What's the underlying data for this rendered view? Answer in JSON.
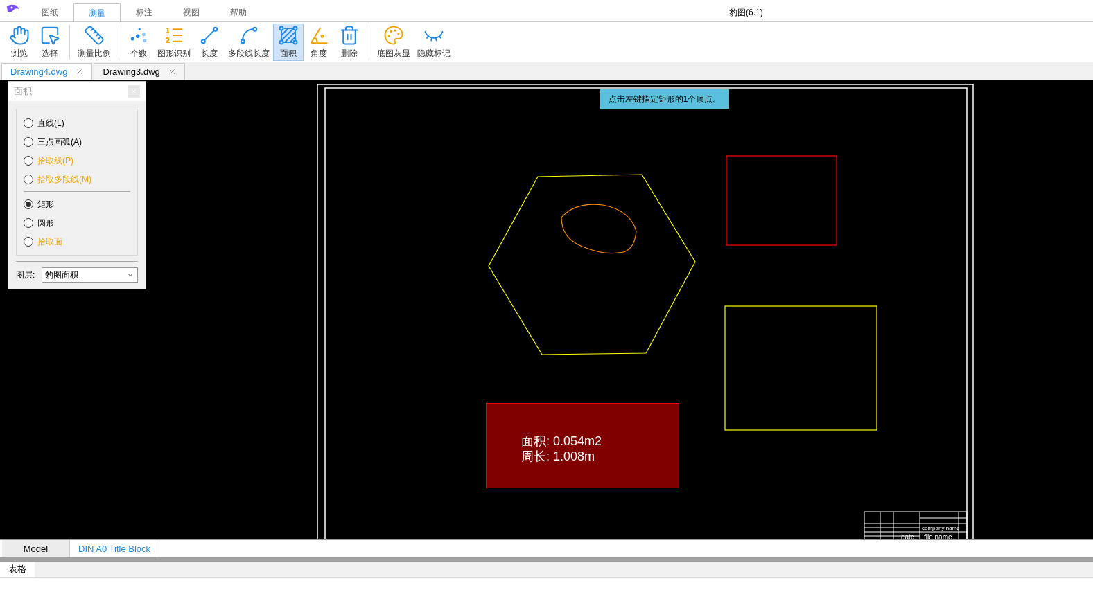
{
  "window": {
    "title": "豹图(6.1)"
  },
  "menu_tabs": [
    {
      "label": "图纸",
      "selected": false
    },
    {
      "label": "测量",
      "selected": true
    },
    {
      "label": "标注",
      "selected": false
    },
    {
      "label": "视图",
      "selected": false
    },
    {
      "label": "帮助",
      "selected": false
    }
  ],
  "toolbar": [
    {
      "kind": "hand",
      "label": "浏览",
      "selected": false,
      "group_start": false
    },
    {
      "kind": "select",
      "label": "选择",
      "selected": false,
      "group_start": false
    },
    {
      "kind": "ruler",
      "label": "测量比例",
      "selected": false,
      "group_start": true
    },
    {
      "kind": "dots",
      "label": "个数",
      "selected": false,
      "group_start": true
    },
    {
      "kind": "list",
      "label": "图形识别",
      "selected": false,
      "group_start": false
    },
    {
      "kind": "line",
      "label": "长度",
      "selected": false,
      "group_start": false
    },
    {
      "kind": "polyline",
      "label": "多段线长度",
      "selected": false,
      "group_start": false
    },
    {
      "kind": "area",
      "label": "面积",
      "selected": true,
      "group_start": false
    },
    {
      "kind": "angle",
      "label": "角度",
      "selected": false,
      "group_start": false
    },
    {
      "kind": "trash",
      "label": "删除",
      "selected": false,
      "group_start": false
    },
    {
      "kind": "palette",
      "label": "底图灰显",
      "selected": false,
      "group_start": true
    },
    {
      "kind": "eye",
      "label": "隐藏标记",
      "selected": false,
      "group_start": false
    }
  ],
  "document_tabs": [
    {
      "label": "Drawing4.dwg",
      "selected": true
    },
    {
      "label": "Drawing3.dwg",
      "selected": false
    }
  ],
  "area_panel": {
    "title": "面积",
    "options": [
      {
        "label": "直线(L)",
        "selected": false,
        "pick": false
      },
      {
        "label": "三点画弧(A)",
        "selected": false,
        "pick": false
      },
      {
        "label": "拾取线(P)",
        "selected": false,
        "pick": true
      },
      {
        "label": "拾取多段线(M)",
        "selected": false,
        "pick": true
      }
    ],
    "shapes": [
      {
        "label": "矩形",
        "selected": true,
        "pick": false
      },
      {
        "label": "圆形",
        "selected": false,
        "pick": false
      },
      {
        "label": "拾取面",
        "selected": false,
        "pick": true
      }
    ],
    "layer_label": "图层:",
    "layer_value": "豹图面积"
  },
  "canvas": {
    "prompt": "点击左键指定矩形的1个顶点。",
    "result": [
      "面积: 0.054m2",
      "周长: 1.008m"
    ],
    "title_block": [
      "company name",
      "date",
      "file name"
    ]
  },
  "layout_tabs": [
    {
      "label": "Model",
      "selected": false
    },
    {
      "label": "DIN A0 Title Block",
      "selected": true
    }
  ],
  "bottom_panel": {
    "tab": "表格"
  }
}
